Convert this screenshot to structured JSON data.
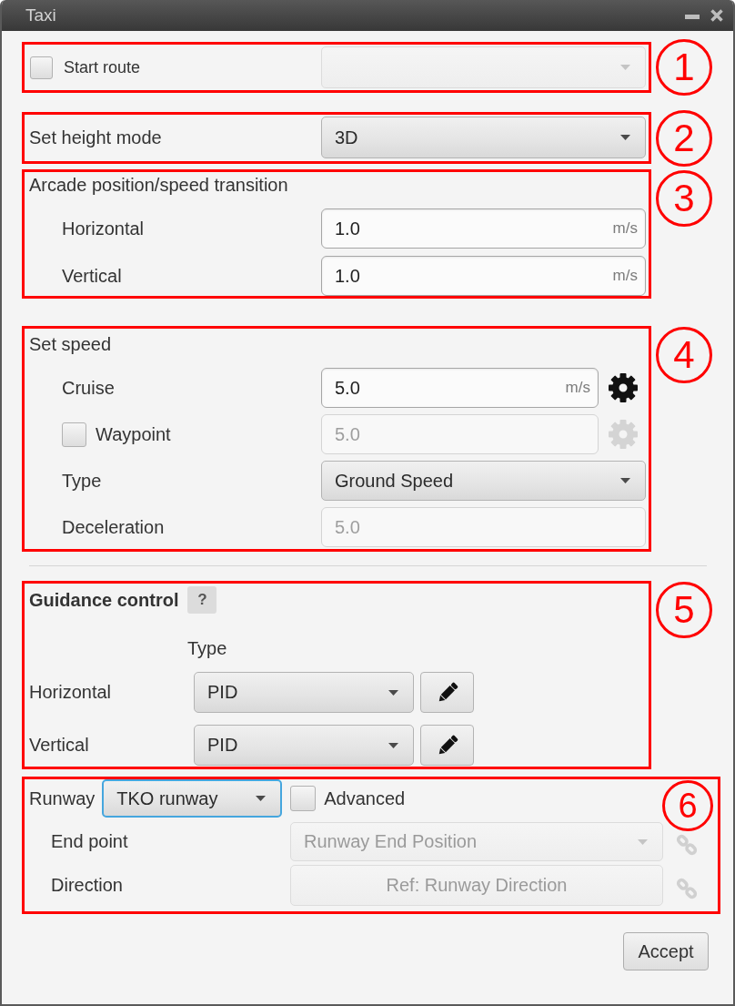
{
  "window": {
    "title": "Taxi"
  },
  "sections": [
    {
      "kind": "form",
      "callout": "1",
      "rows": [
        {
          "kind": "check-dropdown",
          "label": "Start route",
          "checked": false,
          "disabled": true
        }
      ]
    },
    {
      "kind": "form",
      "callout": "2",
      "rows": [
        {
          "kind": "dropdown",
          "label": "Set height mode",
          "value": "3D",
          "disabled": false
        }
      ]
    },
    {
      "kind": "form",
      "callout": "3",
      "heading": "Arcade position/speed transition",
      "rows": [
        {
          "kind": "input",
          "label": "Horizontal",
          "value": "1.0",
          "unit": "m/s",
          "disabled": false
        },
        {
          "kind": "input",
          "label": "Vertical",
          "value": "1.0",
          "unit": "m/s",
          "disabled": false
        }
      ]
    },
    {
      "kind": "form",
      "callout": "4",
      "heading": "Set speed",
      "rows": [
        {
          "kind": "input",
          "label": "Cruise",
          "value": "5.0",
          "unit": "m/s",
          "disabled": false,
          "gear": true
        },
        {
          "kind": "check-input",
          "label": "Waypoint",
          "checked": false,
          "value": "5.0",
          "disabled": true,
          "gear": true
        },
        {
          "kind": "dropdown",
          "label": "Type",
          "value": "Ground Speed",
          "disabled": false
        },
        {
          "kind": "input",
          "label": "Deceleration",
          "value": "5.0",
          "disabled": true
        }
      ]
    },
    {
      "kind": "guidance",
      "callout": "5",
      "heading": "Guidance control",
      "help": "?",
      "column_header": "Type",
      "rows": [
        {
          "label": "Horizontal",
          "value": "PID"
        },
        {
          "label": "Vertical",
          "value": "PID"
        }
      ]
    },
    {
      "kind": "runway",
      "callout": "6",
      "label": "Runway",
      "dropdown": {
        "value": "TKO runway",
        "focused": true
      },
      "advanced": {
        "label": "Advanced",
        "checked": false
      },
      "rows": [
        {
          "kind": "dropdown",
          "label": "End point",
          "value": "Runway End Position",
          "disabled": true
        },
        {
          "kind": "button",
          "label": "Direction",
          "value": "Ref: Runway Direction",
          "disabled": true
        }
      ]
    }
  ],
  "accept_button": "Accept"
}
